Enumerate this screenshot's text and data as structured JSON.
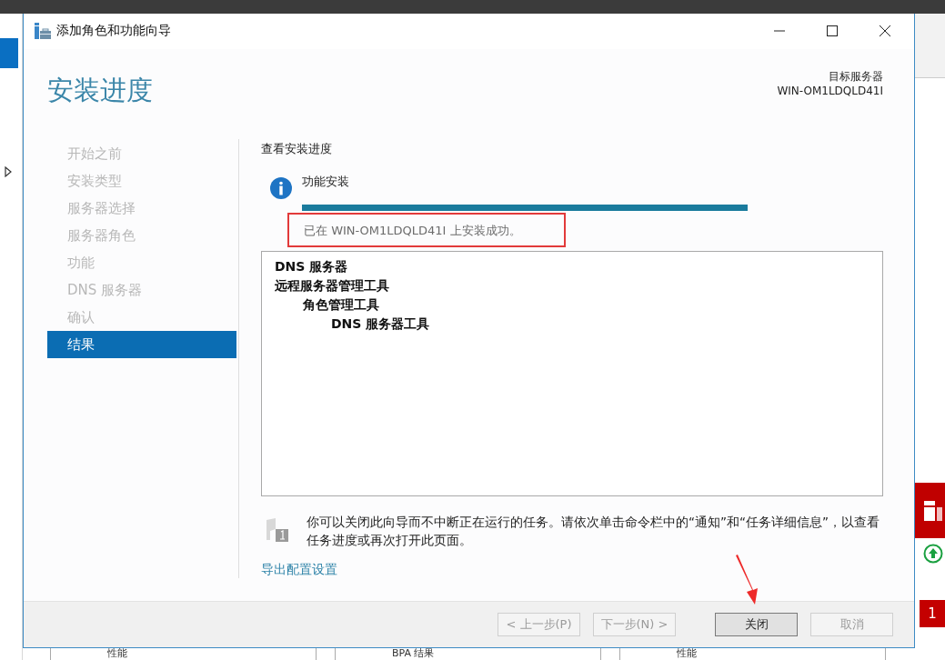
{
  "background_app": {
    "tiles": [
      "性能",
      "BPA 结果",
      "性能"
    ],
    "badge": "1"
  },
  "window": {
    "title": "添加角色和功能向导"
  },
  "header": {
    "title": "安装进度",
    "target_label": "目标服务器",
    "target_server": "WIN-OM1LDQLD41I"
  },
  "steps": [
    {
      "label": "开始之前",
      "selected": false
    },
    {
      "label": "安装类型",
      "selected": false
    },
    {
      "label": "服务器选择",
      "selected": false
    },
    {
      "label": "服务器角色",
      "selected": false
    },
    {
      "label": "功能",
      "selected": false
    },
    {
      "label": "DNS 服务器",
      "selected": false
    },
    {
      "label": "确认",
      "selected": false
    },
    {
      "label": "结果",
      "selected": true
    }
  ],
  "content": {
    "heading": "查看安装进度",
    "status": {
      "label": "功能安装",
      "level": 1,
      "message": "已在 WIN-OM1LDQLD41I 上安装成功。",
      "highlighted": true
    },
    "results": [
      {
        "label": "DNS 服务器"
      },
      {
        "label": "远程服务器管理工具",
        "children": [
          {
            "label": "角色管理工具",
            "children": [
              {
                "label": "DNS 服务器工具"
              }
            ]
          }
        ]
      }
    ],
    "note": "你可以关闭此向导而不中断正在运行的任务。请依次单击命令栏中的“通知”和“任务详细信息”，以查看任务进度或再次打开此页面。",
    "link": "导出配置设置"
  },
  "buttons": [
    {
      "label": "< 上一步(P)",
      "disabled": true,
      "default": false
    },
    {
      "label": "下一步(N) >",
      "disabled": true,
      "default": false
    },
    {
      "label": "关闭",
      "disabled": false,
      "default": true
    },
    {
      "label": "取消",
      "disabled": true,
      "default": false
    }
  ]
}
